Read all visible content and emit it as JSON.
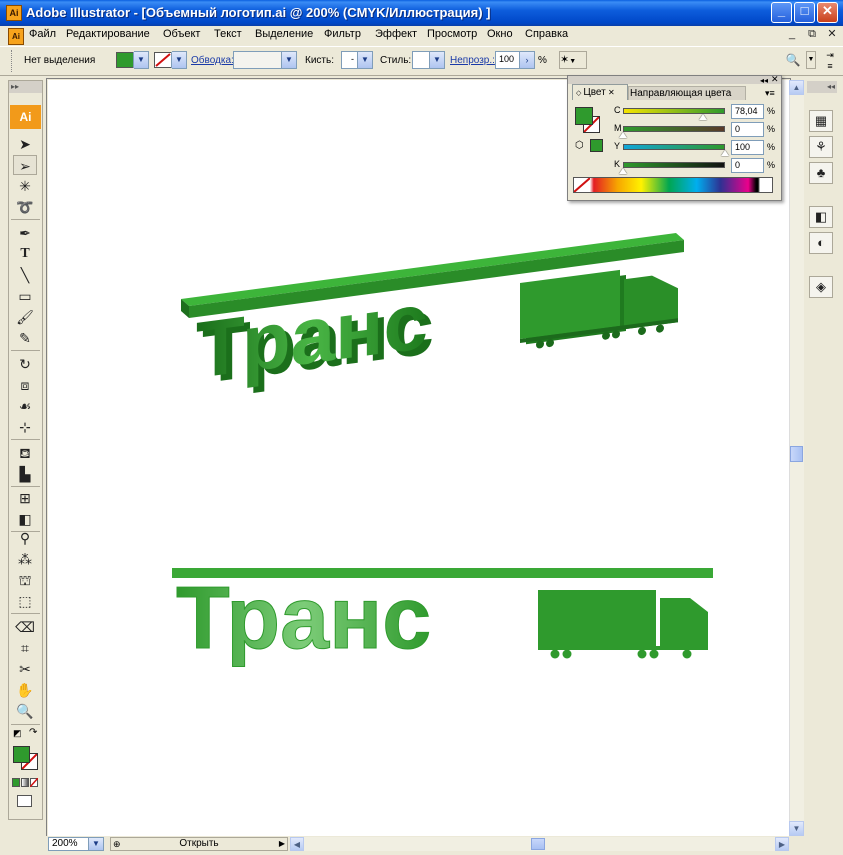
{
  "window": {
    "title": "Adobe Illustrator - [Объемный логотип.ai @ 200% (CMYK/Иллюстрация) ]",
    "app_icon_text": "Ai",
    "buttons": [
      "minimize",
      "maximize",
      "close"
    ]
  },
  "menu": {
    "items": [
      "Файл",
      "Редактирование",
      "Объект",
      "Текст",
      "Выделение",
      "Фильтр",
      "Эффект",
      "Просмотр",
      "Окно",
      "Справка"
    ]
  },
  "controlbar": {
    "selection_label": "Нет выделения",
    "stroke_link": "Обводка:",
    "brush_label": "Кисть:",
    "brush_value": "-",
    "style_label": "Стиль:",
    "opacity_link": "Непрозр.:",
    "opacity_value": "100",
    "opacity_unit": "%",
    "fill_color": "#2f9a2d"
  },
  "tools": {
    "logo": "Ai",
    "icons": [
      "selection-arrow",
      "direct-selection",
      "magic-wand",
      "lasso",
      "pen",
      "type",
      "line-segment",
      "rectangle",
      "paintbrush",
      "pencil",
      "rotate",
      "scale",
      "warp",
      "free-transform",
      "symbol-sprayer",
      "column-graph",
      "mesh",
      "gradient",
      "eyedropper",
      "blend",
      "live-paint-bucket",
      "live-paint-selection",
      "eraser",
      "slice",
      "scissors",
      "hand",
      "zoom"
    ]
  },
  "color_panel": {
    "tab_active": "Цвет",
    "tab_inactive": "Направляющая цвета",
    "channels": [
      {
        "label": "C",
        "value": "78,04",
        "fraction": 0.7804,
        "color": "#00a0d0"
      },
      {
        "label": "M",
        "value": "0",
        "fraction": 0,
        "color": "#e0209a"
      },
      {
        "label": "Y",
        "value": "100",
        "fraction": 1,
        "color": "#f5e400"
      },
      {
        "label": "K",
        "value": "0",
        "fraction": 0,
        "color": "#222222"
      }
    ],
    "unit": "%"
  },
  "canvas": {
    "logo_3d_text": "Транс",
    "logo_flat_text": "Транс",
    "logo_color": "#2f9a2d"
  },
  "statusbar": {
    "zoom": "200%",
    "status": "Открыть"
  }
}
